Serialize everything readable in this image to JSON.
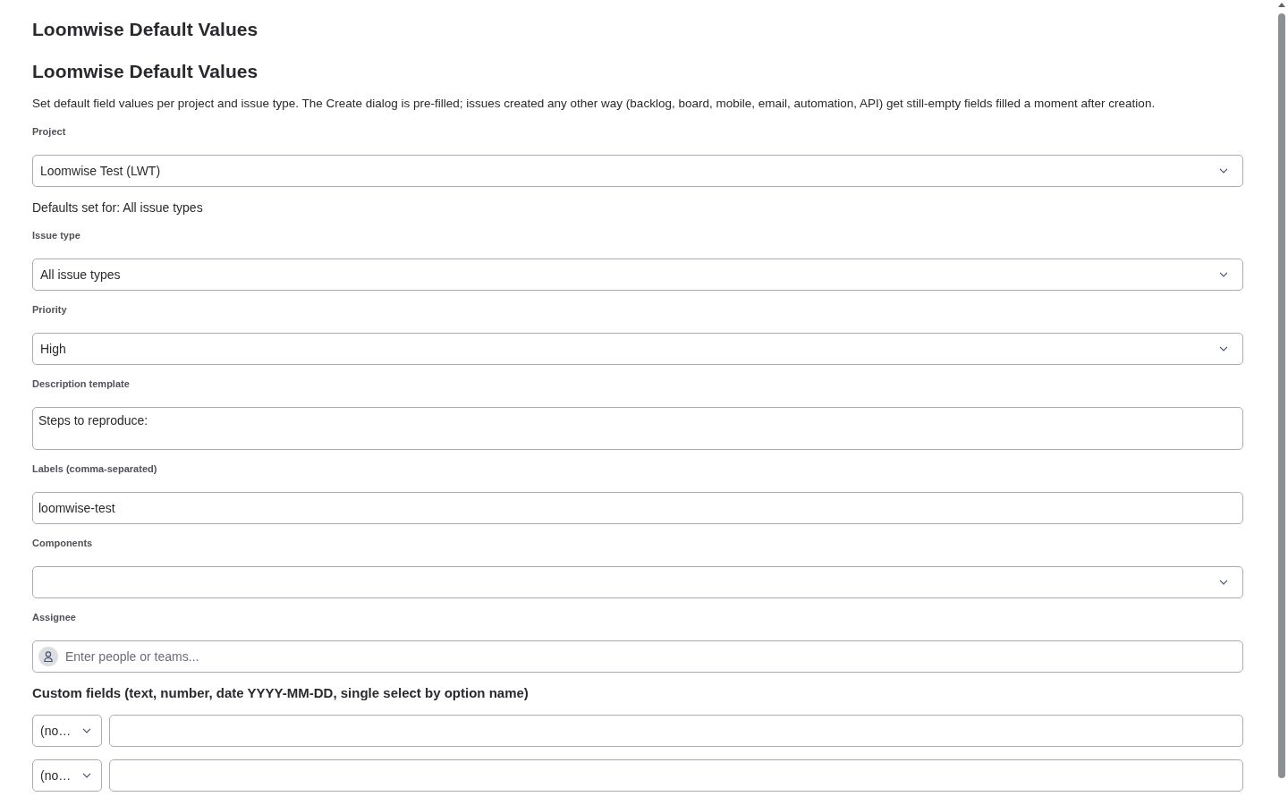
{
  "page": {
    "title": "Loomwise Default Values"
  },
  "heading": "Loomwise Default Values",
  "description": "Set default field values per project and issue type. The Create dialog is pre-filled; issues created any other way (backlog, board, mobile, email, automation, API) get still-empty fields filled a moment after creation.",
  "fields": [
    {
      "kind": "select",
      "label": "Project",
      "value": "Loomwise Test (LWT)"
    },
    {
      "kind": "note",
      "text": "Defaults set for: All issue types"
    },
    {
      "kind": "select",
      "label": "Issue type",
      "value": "All issue types"
    },
    {
      "kind": "select",
      "label": "Priority",
      "value": "High"
    },
    {
      "kind": "textarea",
      "label": "Description template",
      "value": "Steps to reproduce:"
    },
    {
      "kind": "text",
      "label": "Labels (comma-separated)",
      "value": "loomwise-test"
    },
    {
      "kind": "select",
      "label": "Components"
    },
    {
      "kind": "people",
      "label": "Assignee",
      "placeholder": "Enter people or teams..."
    }
  ],
  "custom_fields": {
    "title": "Custom fields (text, number, date YYYY-MM-DD, single select by option name)",
    "rows": [
      {
        "field": "(no…"
      },
      {
        "field": "(no…"
      }
    ]
  }
}
